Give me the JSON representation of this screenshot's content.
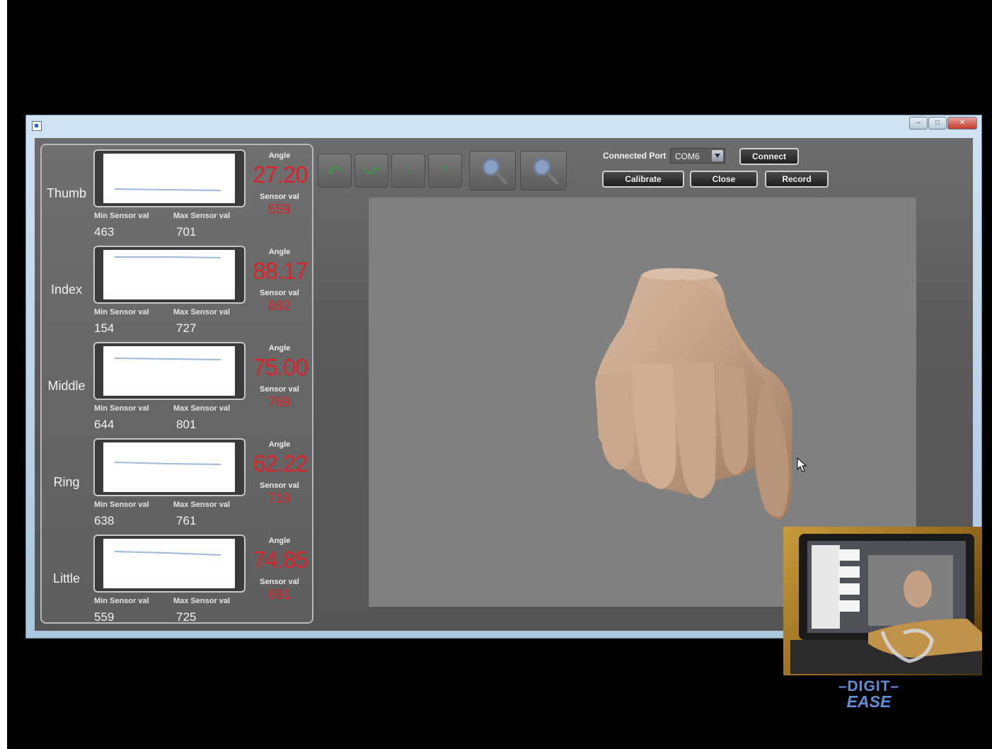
{
  "app": {
    "connected_port_label": "Connected Port",
    "port_value": "COM6",
    "buttons": {
      "connect": "Connect",
      "calibrate": "Calibrate",
      "close": "Close",
      "record": "Record"
    }
  },
  "labels": {
    "angle": "Angle",
    "sensor_val": "Sensor val",
    "min_sensor_val": "Min Sensor val",
    "max_sensor_val": "Max Sensor val"
  },
  "fingers": [
    {
      "name": "Thumb",
      "angle": "27.20",
      "sensor": "559",
      "min": "463",
      "max": "701"
    },
    {
      "name": "Index",
      "angle": "88.17",
      "sensor": "692",
      "min": "154",
      "max": "727"
    },
    {
      "name": "Middle",
      "angle": "75.00",
      "sensor": "769",
      "min": "644",
      "max": "801"
    },
    {
      "name": "Ring",
      "angle": "62.22",
      "sensor": "719",
      "min": "638",
      "max": "761"
    },
    {
      "name": "Little",
      "angle": "74.85",
      "sensor": "691",
      "min": "559",
      "max": "725"
    }
  ],
  "colors": {
    "value_red": "#d9232a",
    "chart_line": "#9fb8de",
    "toolbar_green": "#3b9a3d",
    "brand_blue": "#5f8fd6"
  },
  "icons": [
    "hand-model",
    "zoom-in-icon",
    "zoom-out-icon",
    "cursor-icon",
    "dropdown-arrow-icon"
  ],
  "brand": {
    "line1": "DIGIT",
    "line2": "EASE"
  }
}
